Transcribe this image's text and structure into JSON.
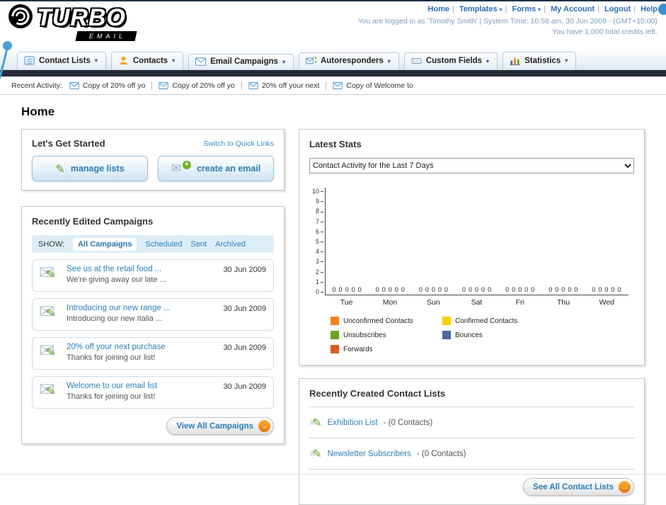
{
  "header": {
    "logo": {
      "main": "TURBO",
      "sub": "EMAIL"
    },
    "links": [
      {
        "label": "Home"
      },
      {
        "label": "Templates",
        "dropdown": true
      },
      {
        "label": "Forms",
        "dropdown": true
      },
      {
        "label": "My Account"
      },
      {
        "label": "Logout"
      },
      {
        "label": "Help"
      }
    ],
    "session_text": "You are logged in as 'Timothy Smith' | System Time: 10:58 am, 30 Jun 2009 - (GMT+10:00)",
    "credits_text": "You have 1,000 total credits left."
  },
  "nav": {
    "tabs": [
      {
        "label": "Contact Lists"
      },
      {
        "label": "Contacts"
      },
      {
        "label": "Email Campaigns"
      },
      {
        "label": "Autoresponders"
      },
      {
        "label": "Custom Fields"
      },
      {
        "label": "Statistics"
      }
    ]
  },
  "recent_activity": {
    "label": "Recent Activity:",
    "items": [
      {
        "text": "Copy of 20% off yo"
      },
      {
        "text": "Copy of 20% off yo"
      },
      {
        "text": "20% off your next"
      },
      {
        "text": "Copy of Welcome to"
      }
    ]
  },
  "page_title": "Home",
  "get_started": {
    "title": "Let's Get Started",
    "switch_link": "Switch to Quick Links",
    "buttons": [
      {
        "label": "manage lists"
      },
      {
        "label": "create an email"
      }
    ]
  },
  "campaigns": {
    "title": "Recently Edited Campaigns",
    "show_label": "SHOW:",
    "tabs": [
      {
        "label": "All Campaigns",
        "active": true
      },
      {
        "label": "Scheduled"
      },
      {
        "label": "Sent"
      },
      {
        "label": "Archived"
      }
    ],
    "items": [
      {
        "title": "See us at the retail food ...",
        "subtitle": "We're giving away our late ...",
        "date": "30 Jun 2009"
      },
      {
        "title": "Introducing our new range ...",
        "subtitle": "Introducing our new Italia ...",
        "date": "30 Jun 2009"
      },
      {
        "title": "20% off your next purchase",
        "subtitle": "Thanks for joining our list!",
        "date": "30 Jun 2009"
      },
      {
        "title": "Welcome to our email list",
        "subtitle": "Thanks for joining our list!",
        "date": "30 Jun 2009"
      }
    ],
    "view_all_label": "View All Campaigns"
  },
  "stats": {
    "title": "Latest Stats",
    "dropdown_value": "Contact Activity for the Last 7 Days",
    "chart_data": {
      "type": "bar",
      "title": "Contact Activity for the Last 7 Days",
      "categories": [
        "Tue",
        "Mon",
        "Sun",
        "Sat",
        "Fri",
        "Thu",
        "Wed"
      ],
      "series": [
        {
          "name": "Unconfirmed Contacts",
          "values": [
            0,
            0,
            0,
            0,
            0,
            0,
            0
          ]
        },
        {
          "name": "Confirmed Contacts",
          "values": [
            0,
            0,
            0,
            0,
            0,
            0,
            0
          ]
        },
        {
          "name": "Unsubscribes",
          "values": [
            0,
            0,
            0,
            0,
            0,
            0,
            0
          ]
        },
        {
          "name": "Bounces",
          "values": [
            0,
            0,
            0,
            0,
            0,
            0,
            0
          ]
        },
        {
          "name": "Forwards",
          "values": [
            0,
            0,
            0,
            0,
            0,
            0,
            0
          ]
        }
      ],
      "xlabel": "",
      "ylabel": "",
      "ylim": [
        0,
        10
      ],
      "grid": false,
      "legend_position": "bottom",
      "data_labels": true
    },
    "legend": [
      {
        "label": "Unconfirmed Contacts",
        "color": "#f5821f"
      },
      {
        "label": "Confirmed Contacts",
        "color": "#ffcc00"
      },
      {
        "label": "Unsubscribes",
        "color": "#69a51e"
      },
      {
        "label": "Bounces",
        "color": "#4a69a5"
      },
      {
        "label": "Forwards",
        "color": "#e05a20"
      }
    ]
  },
  "contact_lists": {
    "title": "Recently Created Contact Lists",
    "items": [
      {
        "name": "Exhibition List",
        "detail": "- (0 Contacts)"
      },
      {
        "name": "Newsletter Subscribers",
        "detail": "- (0 Contacts)"
      }
    ],
    "see_all_label": "See All Contact Lists"
  }
}
